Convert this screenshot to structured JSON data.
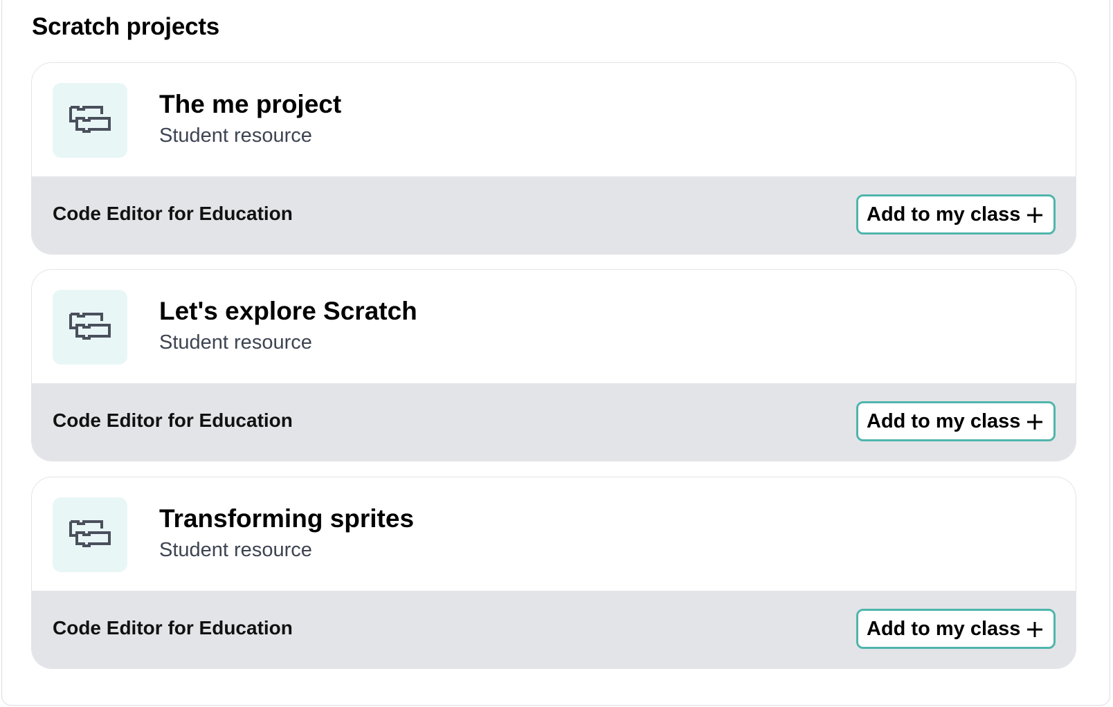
{
  "section": {
    "title": "Scratch projects"
  },
  "cards": [
    {
      "title": "The me project",
      "subtitle": "Student resource",
      "platform": "Code Editor for Education",
      "button_label": "Add to my class",
      "icon": "scratch-blocks-icon"
    },
    {
      "title": "Let's explore Scratch",
      "subtitle": "Student resource",
      "platform": "Code Editor for Education",
      "button_label": "Add to my class",
      "icon": "scratch-blocks-icon"
    },
    {
      "title": "Transforming sprites",
      "subtitle": "Student resource",
      "platform": "Code Editor for Education",
      "button_label": "Add to my class",
      "icon": "scratch-blocks-icon"
    }
  ],
  "colors": {
    "accent": "#4fb5ac",
    "icon_tile_bg": "#e8f6f6",
    "footer_bg": "#e3e4e8",
    "icon_stroke": "#4a4f5c"
  }
}
